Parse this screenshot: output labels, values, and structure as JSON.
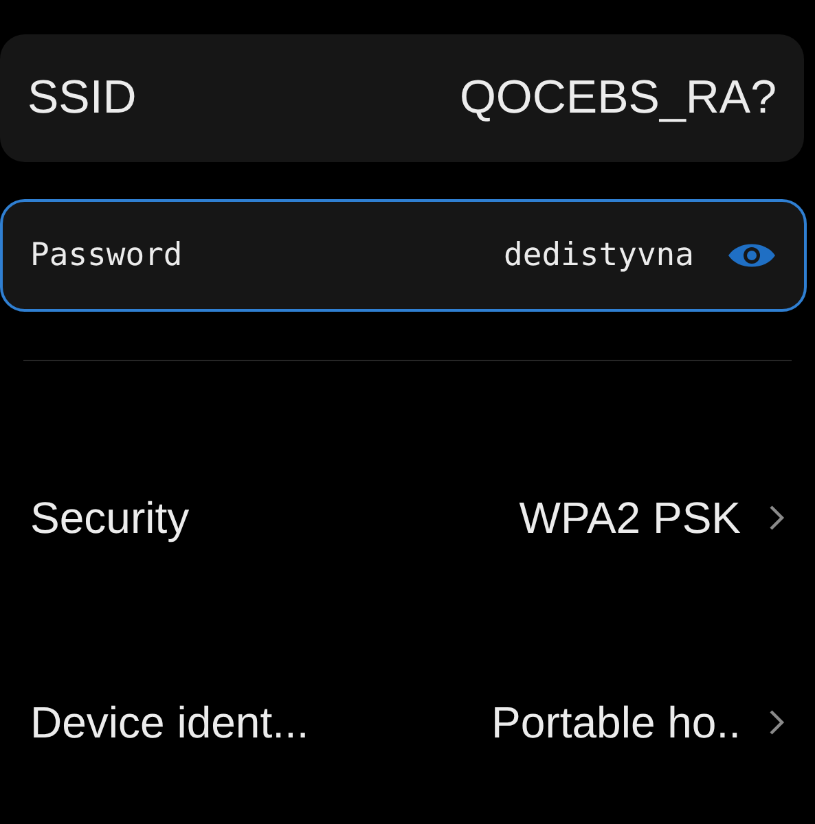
{
  "ssid": {
    "label": "SSID",
    "value": "QOCEBS_RA?"
  },
  "password": {
    "label": "Password",
    "value": "dedistyvna",
    "focused": true
  },
  "settings": [
    {
      "label": "Security",
      "value": "WPA2 PSK"
    },
    {
      "label": "Device ident...",
      "value": "Portable ho.."
    }
  ]
}
